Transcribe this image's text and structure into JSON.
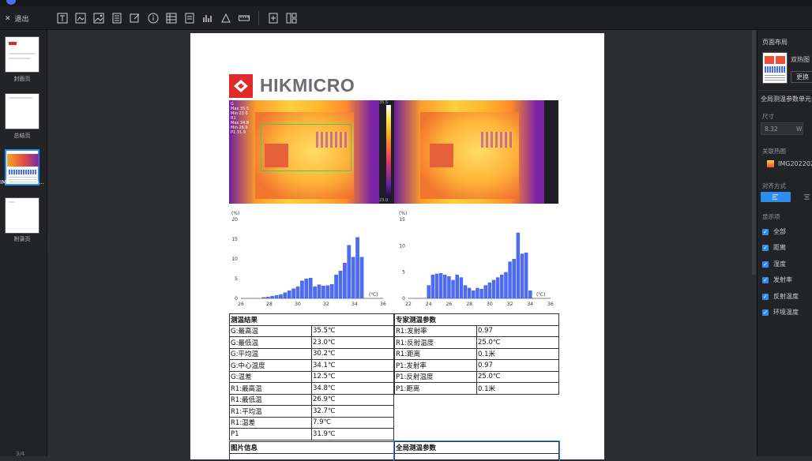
{
  "toolbar": {
    "exit_label": "退出"
  },
  "left_panel": {
    "pages": [
      {
        "label": "封面页"
      },
      {
        "label": "总结页"
      },
      {
        "label": "IMG20220223..."
      },
      {
        "label": "附录页"
      }
    ],
    "page_count": "3/4"
  },
  "report": {
    "brand": "HIKMICRO",
    "overlay": {
      "lines": [
        "G",
        "Max 35.5",
        "Min 23.0",
        "R1",
        "Max 34.8",
        "Min 26.9",
        "P1 31.9"
      ],
      "scale_max": "35.5",
      "scale_min": "23.0"
    },
    "results_title": "测温结果",
    "results": [
      {
        "label": "G:最高温",
        "value": "35.5℃"
      },
      {
        "label": "G:最低温",
        "value": "23.0℃"
      },
      {
        "label": "G:平均温",
        "value": "30.2℃"
      },
      {
        "label": "G:中心温度",
        "value": "34.1℃"
      },
      {
        "label": "G:温差",
        "value": "12.5℃"
      },
      {
        "label": "R1:最高温",
        "value": "34.8℃"
      },
      {
        "label": "R1:最低温",
        "value": "26.9℃"
      },
      {
        "label": "R1:平均温",
        "value": "32.7℃"
      },
      {
        "label": "R1:温差",
        "value": "7.9℃"
      },
      {
        "label": "P1",
        "value": "31.9℃"
      }
    ],
    "params_title": "专家测温参数",
    "params": [
      {
        "label": "R1:发射率",
        "value": "0.97"
      },
      {
        "label": "R1:反射温度",
        "value": "25.0℃"
      },
      {
        "label": "R1:距离",
        "value": "0.1米"
      },
      {
        "label": "P1:发射率",
        "value": "0.97"
      },
      {
        "label": "P1:反射温度",
        "value": "25.0℃"
      },
      {
        "label": "P1:距离",
        "value": "0.1米"
      }
    ],
    "image_info_title": "图片信息",
    "global_params_title": "全局测温参数"
  },
  "right_panel": {
    "layout_title": "页面布局",
    "layout_name": "双热图",
    "change_button": "更换",
    "global_unit_title": "全局测温参数单元",
    "size_label": "尺寸",
    "size_value": "8.32",
    "size_unit": "W",
    "linked_label": "关联热图",
    "linked_value": "IMG2022022",
    "align_label": "对齐方式",
    "display_label": "显示项",
    "options": [
      {
        "label": "全部",
        "checked": true
      },
      {
        "label": "距离",
        "checked": true
      },
      {
        "label": "湿度",
        "checked": true
      },
      {
        "label": "发射率",
        "checked": true
      },
      {
        "label": "反射温度",
        "checked": true
      },
      {
        "label": "环境温度",
        "checked": true
      }
    ]
  },
  "chart_data": [
    {
      "type": "bar",
      "ylabel": "(%)",
      "xlabel": "(℃)",
      "xlim": [
        26,
        36
      ],
      "ylim": [
        0,
        20
      ],
      "x_ticks": [
        26,
        28,
        30,
        32,
        34,
        36
      ],
      "y_ticks": [
        0,
        5,
        10,
        15,
        20
      ],
      "x": [
        27.6,
        27.9,
        28.2,
        28.5,
        28.8,
        29.1,
        29.4,
        29.7,
        30.0,
        30.3,
        30.6,
        30.9,
        31.2,
        31.5,
        31.8,
        32.1,
        32.4,
        32.7,
        33.0,
        33.3,
        33.6,
        33.9,
        34.2,
        34.5
      ],
      "values": [
        0.3,
        0.4,
        0.6,
        0.8,
        1.0,
        1.5,
        2.0,
        2.5,
        3.0,
        4.5,
        5.0,
        5.2,
        3.0,
        3.5,
        3.2,
        3.3,
        3.6,
        6.0,
        7.0,
        9.0,
        13.5,
        10.5,
        15.5,
        10.5
      ]
    },
    {
      "type": "bar",
      "ylabel": "(%)",
      "xlabel": "(℃)",
      "xlim": [
        22,
        36
      ],
      "ylim": [
        0,
        15
      ],
      "x_ticks": [
        22,
        24,
        26,
        28,
        30,
        32,
        34,
        36
      ],
      "y_ticks": [
        0,
        5,
        10,
        15
      ],
      "x": [
        24.0,
        24.4,
        24.8,
        25.2,
        25.6,
        26.0,
        26.4,
        26.8,
        27.2,
        27.6,
        28.0,
        28.4,
        28.8,
        29.2,
        29.6,
        30.0,
        30.4,
        30.8,
        31.2,
        31.6,
        32.0,
        32.4,
        32.8,
        33.2,
        33.6,
        34.0
      ],
      "values": [
        2.5,
        4.5,
        4.7,
        4.8,
        4.5,
        4.2,
        3.5,
        4.5,
        4.0,
        2.5,
        2.0,
        1.5,
        2.0,
        1.8,
        2.5,
        3.0,
        3.5,
        4.0,
        4.5,
        5.0,
        7.0,
        7.5,
        12.5,
        8.5,
        8.7,
        1.5
      ]
    }
  ]
}
